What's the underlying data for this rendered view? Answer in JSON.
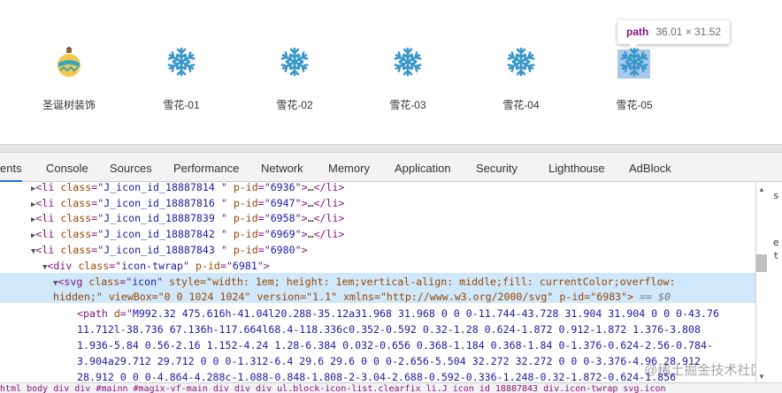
{
  "icons": [
    {
      "label": "圣诞树装饰",
      "icon": "christmas-ornament"
    },
    {
      "label": "雪花-01",
      "icon": "snowflake"
    },
    {
      "label": "雪花-02",
      "icon": "snowflake"
    },
    {
      "label": "雪花-03",
      "icon": "snowflake"
    },
    {
      "label": "雪花-04",
      "icon": "snowflake"
    },
    {
      "label": "雪花-05",
      "icon": "snowflake"
    }
  ],
  "tooltip": {
    "tag": "path",
    "dims": "36.01 × 31.52"
  },
  "colors": {
    "icon": "#3a97c9",
    "ornament_yellow": "#f2c94c",
    "ornament_teal": "#3aa6b9",
    "selected_row": "#cfe8fc",
    "active_tab": "#1a73e8"
  },
  "tabs": [
    "ents",
    "Console",
    "Sources",
    "Performance",
    "Network",
    "Memory",
    "Application",
    "Security",
    "Lighthouse",
    "AdBlock"
  ],
  "lines": [
    {
      "cls": "J_icon_id_18887814 ",
      "pid": "6936"
    },
    {
      "cls": "J_icon_id_18887816 ",
      "pid": "6947"
    },
    {
      "cls": "J_icon_id_18887839 ",
      "pid": "6958"
    },
    {
      "cls": "J_icon_id_18887842 ",
      "pid": "6969"
    },
    {
      "cls": "J_icon_id_18887843 ",
      "pid": "6980"
    }
  ],
  "div_line": {
    "cls": "icon-twrap",
    "pid": "6981"
  },
  "svg_line1": "style=\"width: 1em; height: 1em;vertical-align: middle;fill: currentColor;overflow:",
  "svg_line2a": "hidden;\" viewBox=\"0 0 1024 1024\" version=\"1.1\" xmlns=\"http://www.w3.org/2000/svg\" p-id=\"6983\"> ",
  "svg_eq": "== $0",
  "path_lines": [
    "M992.32 475.616h-41.04l20.288-35.12a31.968 31.968 0 0 0-11.744-43.728 31.904 31.904 0 0 0-43.76",
    "11.712l-38.736 67.136h-117.664l68.4-118.336c0.352-0.592 0.32-1.28 0.624-1.872 0.912-1.872 1.376-3.808",
    "1.936-5.84 0.56-2.16 1.152-4.24 1.28-6.384 0.032-0.656 0.368-1.184 0.368-1.84 0-1.376-0.624-2.56-0.784-",
    "3.904a29.712 29.712 0 0 0-1.312-6.4 29.6 29.6 0 0 0-2.656-5.504 32.272 32.272 0 0 0-3.376-4.96 28.912",
    "28.912 0 0 0-4.864-4.288c-1.088-0.848-1.808-2-3.04-2.688-0.592-0.336-1.248-0.32-1.872-0.624-1.856"
  ],
  "breadcrumb": "html  body  div  div  #mainn  #magix-vf-main  div  div  div  ul.block-icon-list.clearfix  li.J_icon_id_18887843  div.icon-twrap  svg.icon",
  "right_pane": [
    "s",
    "e",
    "t"
  ],
  "watermark": "@稀土掘金技术社区"
}
